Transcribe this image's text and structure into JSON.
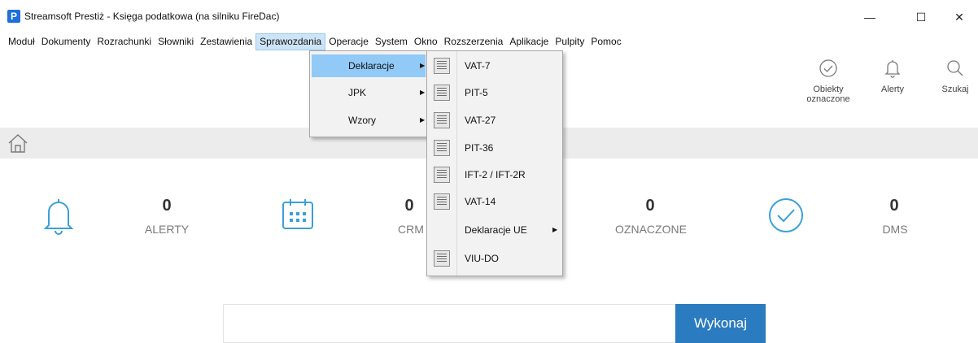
{
  "window": {
    "title": "Streamsoft Prestiż - Księga podatkowa (na silniku FireDac)",
    "app_icon_letter": "P",
    "min_glyph": "—",
    "max_glyph": "☐",
    "close_glyph": "✕"
  },
  "menubar": {
    "items": [
      "Moduł",
      "Dokumenty",
      "Rozrachunki",
      "Słowniki",
      "Zestawienia",
      "Sprawozdania",
      "Operacje",
      "System",
      "Okno",
      "Rozszerzenia",
      "Aplikacje",
      "Pulpity",
      "Pomoc"
    ],
    "active": "Sprawozdania"
  },
  "toolbar": {
    "obiekty_line1": "Obiekty",
    "obiekty_line2": "oznaczone",
    "alerty": "Alerty",
    "szukaj": "Szukaj"
  },
  "stats": [
    {
      "value": "0",
      "label": "ALERTY",
      "icon": "bell-icon"
    },
    {
      "value": "0",
      "label": "CRM",
      "icon": "calendar-icon"
    },
    {
      "value": "0",
      "label": "OZNACZONE",
      "icon": "checkmark-circle-icon"
    },
    {
      "value": "0",
      "label": "DMS",
      "icon": "none"
    }
  ],
  "command": {
    "input_value": "",
    "button_label": "Wykonaj"
  },
  "menu_sprawozdania": {
    "items": [
      "Deklaracje",
      "JPK",
      "Wzory"
    ],
    "selected": "Deklaracje"
  },
  "menu_deklaracje": {
    "items": [
      "VAT-7",
      "PIT-5",
      "VAT-27",
      "PIT-36",
      "IFT-2 / IFT-2R",
      "VAT-14",
      "Deklaracje UE",
      "VIU-DO"
    ]
  },
  "colors": {
    "accent": "#2a7bbf",
    "icon_blue": "#3aa0d8",
    "menu_highlight": "#91c9f7"
  }
}
